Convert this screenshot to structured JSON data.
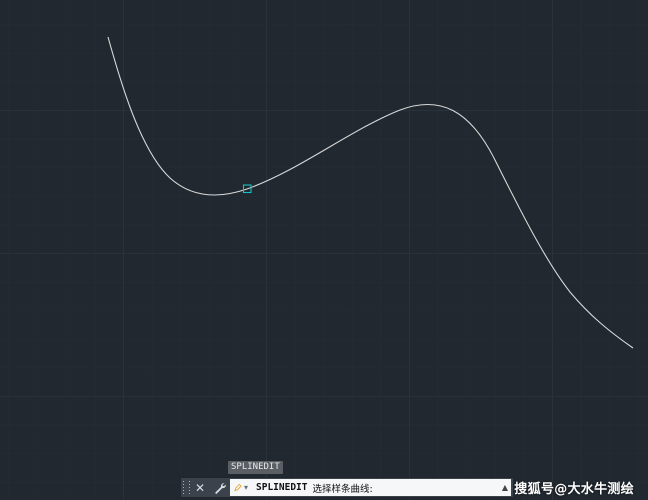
{
  "canvas": {
    "background_color": "#212830",
    "major_grid_color": "#2d3540",
    "minor_grid_color": "#262e38",
    "spline_color": "#d8d8d8",
    "grip_color": "#19c2c2"
  },
  "tooltip": {
    "text": "SPLINEDIT"
  },
  "command_bar": {
    "close_icon": "close-icon",
    "customize_icon": "wrench-icon",
    "command_name": "SPLINEDIT",
    "prompt_text": "选择样条曲线:",
    "recent_commands_icon": "chevron-up-icon"
  },
  "watermark": {
    "text": "搜狐号@大水牛测绘"
  }
}
